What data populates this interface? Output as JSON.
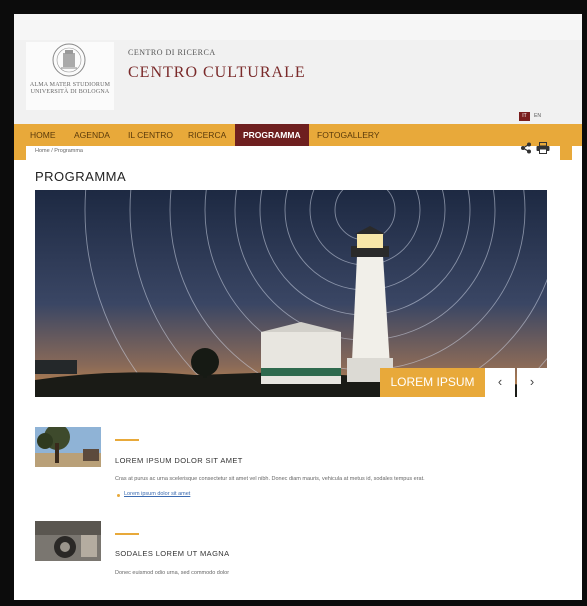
{
  "header": {
    "university_lines": [
      "ALMA MATER STUDIORUM",
      "UNIVERSITÀ DI BOLOGNA"
    ],
    "subtitle": "CENTRO DI RICERCA",
    "title": "CENTRO CULTURALE",
    "languages": [
      "IT",
      "EN"
    ]
  },
  "nav": {
    "items": [
      "HOME",
      "AGENDA",
      "IL CENTRO",
      "RICERCA",
      "PROGRAMMA",
      "FOTOGALLERY"
    ],
    "active": "PROGRAMMA"
  },
  "breadcrumb": "Home / Programma",
  "page_title": "PROGRAMMA",
  "hero": {
    "caption": "LOREM IPSUM",
    "prev": "‹",
    "next": "›"
  },
  "items": [
    {
      "title": "LOREM IPSUM DOLOR SIT AMET",
      "text": "Cras at purus ac urna scelerisque consectetur sit amet vel nibh. Donec diam mauris, vehicula at metus id, sodales tempus erat.",
      "link": "Lorem ipsum dolor sit amet"
    },
    {
      "title": "SODALES LOREM UT MAGNA",
      "text": "Donec euismod odio urna, sed commodo dolor"
    }
  ],
  "colors": {
    "accent": "#e8a93a",
    "active_nav": "#6e1f1f",
    "title_red": "#7a2a2a"
  },
  "icons": [
    "share-icon",
    "print-icon",
    "chevron-left-icon",
    "chevron-right-icon"
  ]
}
